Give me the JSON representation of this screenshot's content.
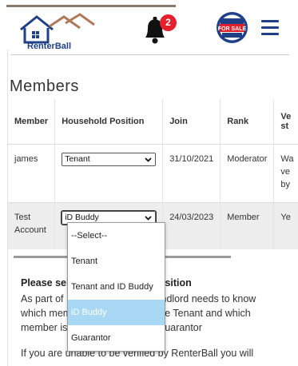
{
  "header": {
    "brand": "RenterBall",
    "notification_count": "2",
    "colors": {
      "brand_blue": "#1f3f86",
      "badge_red": "#e5202d",
      "roof_orange": "#b07a5a"
    }
  },
  "members": {
    "title": "Members",
    "columns": [
      "Member",
      "Household Position",
      "Join",
      "Rank"
    ],
    "verified_col_fragments": [
      "Ve",
      "st"
    ],
    "rows": [
      {
        "member": "james",
        "position": "Tenant",
        "join": "31/10/2021",
        "rank": "Moderator",
        "verified_fragments": [
          "Wa",
          "ve",
          "by"
        ]
      },
      {
        "member_line1": "Test",
        "member_line2": "Account",
        "position": "iD Buddy",
        "join": "24/03/2023",
        "rank": "Member",
        "verified_fragments": [
          "Ye"
        ]
      }
    ]
  },
  "dropdown": {
    "options": [
      "--Select--",
      "Tenant",
      "Tenant and ID Buddy",
      "iD Buddy",
      "Guarantor"
    ],
    "selected_index": 3
  },
  "info": {
    "title_visible": "Please sel",
    "title_visible_2": "sition",
    "para1_line1_left": "As part of",
    "para1_line1_right": "ndlord needs to know",
    "para1_line2_left": "which mem",
    "para1_line2_right": "e Tenant and which",
    "para1_line3_left": "member is",
    "para1_line3_right": "uarantor",
    "para2_line1": "If you are unable to be verified by RenterBall you will"
  }
}
